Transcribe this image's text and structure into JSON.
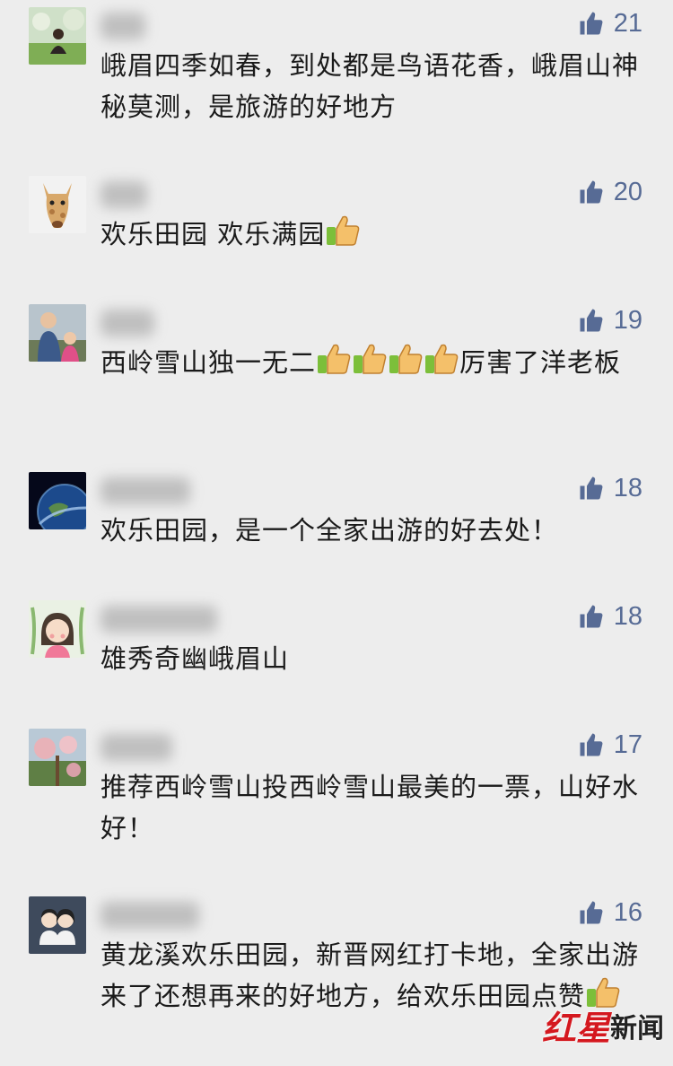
{
  "comments": [
    {
      "likes": "21",
      "segments": [
        "峨眉四季如春，到处都是鸟语花香，峨眉山神秘莫测，是旅游的好地方"
      ]
    },
    {
      "likes": "20",
      "segments": [
        "欢乐田园 欢乐满园"
      ]
    },
    {
      "likes": "19",
      "segments": [
        "西岭雪山独一无二",
        "厉害了洋老板"
      ]
    },
    {
      "likes": "18",
      "segments": [
        "欢乐田园，是一个全家出游的好去处！"
      ]
    },
    {
      "likes": "18",
      "segments": [
        "雄秀奇幽峨眉山"
      ]
    },
    {
      "likes": "17",
      "segments": [
        "推荐西岭雪山投西岭雪山最美的一票，山好水好！"
      ]
    },
    {
      "likes": "16",
      "segments": [
        "黄龙溪欢乐田园，新晋网红打卡地，全家出游来了还想再来的好地方，给欢乐田园点赞"
      ]
    }
  ],
  "icons": {
    "like": "thumbs-up-icon",
    "emoji": "thumbs-up-emoji"
  },
  "colors": {
    "background": "#ededed",
    "like_color": "#576b95",
    "watermark_red": "#d4181f"
  },
  "watermark": {
    "brand_red": "红星",
    "brand_dark": "新闻"
  }
}
